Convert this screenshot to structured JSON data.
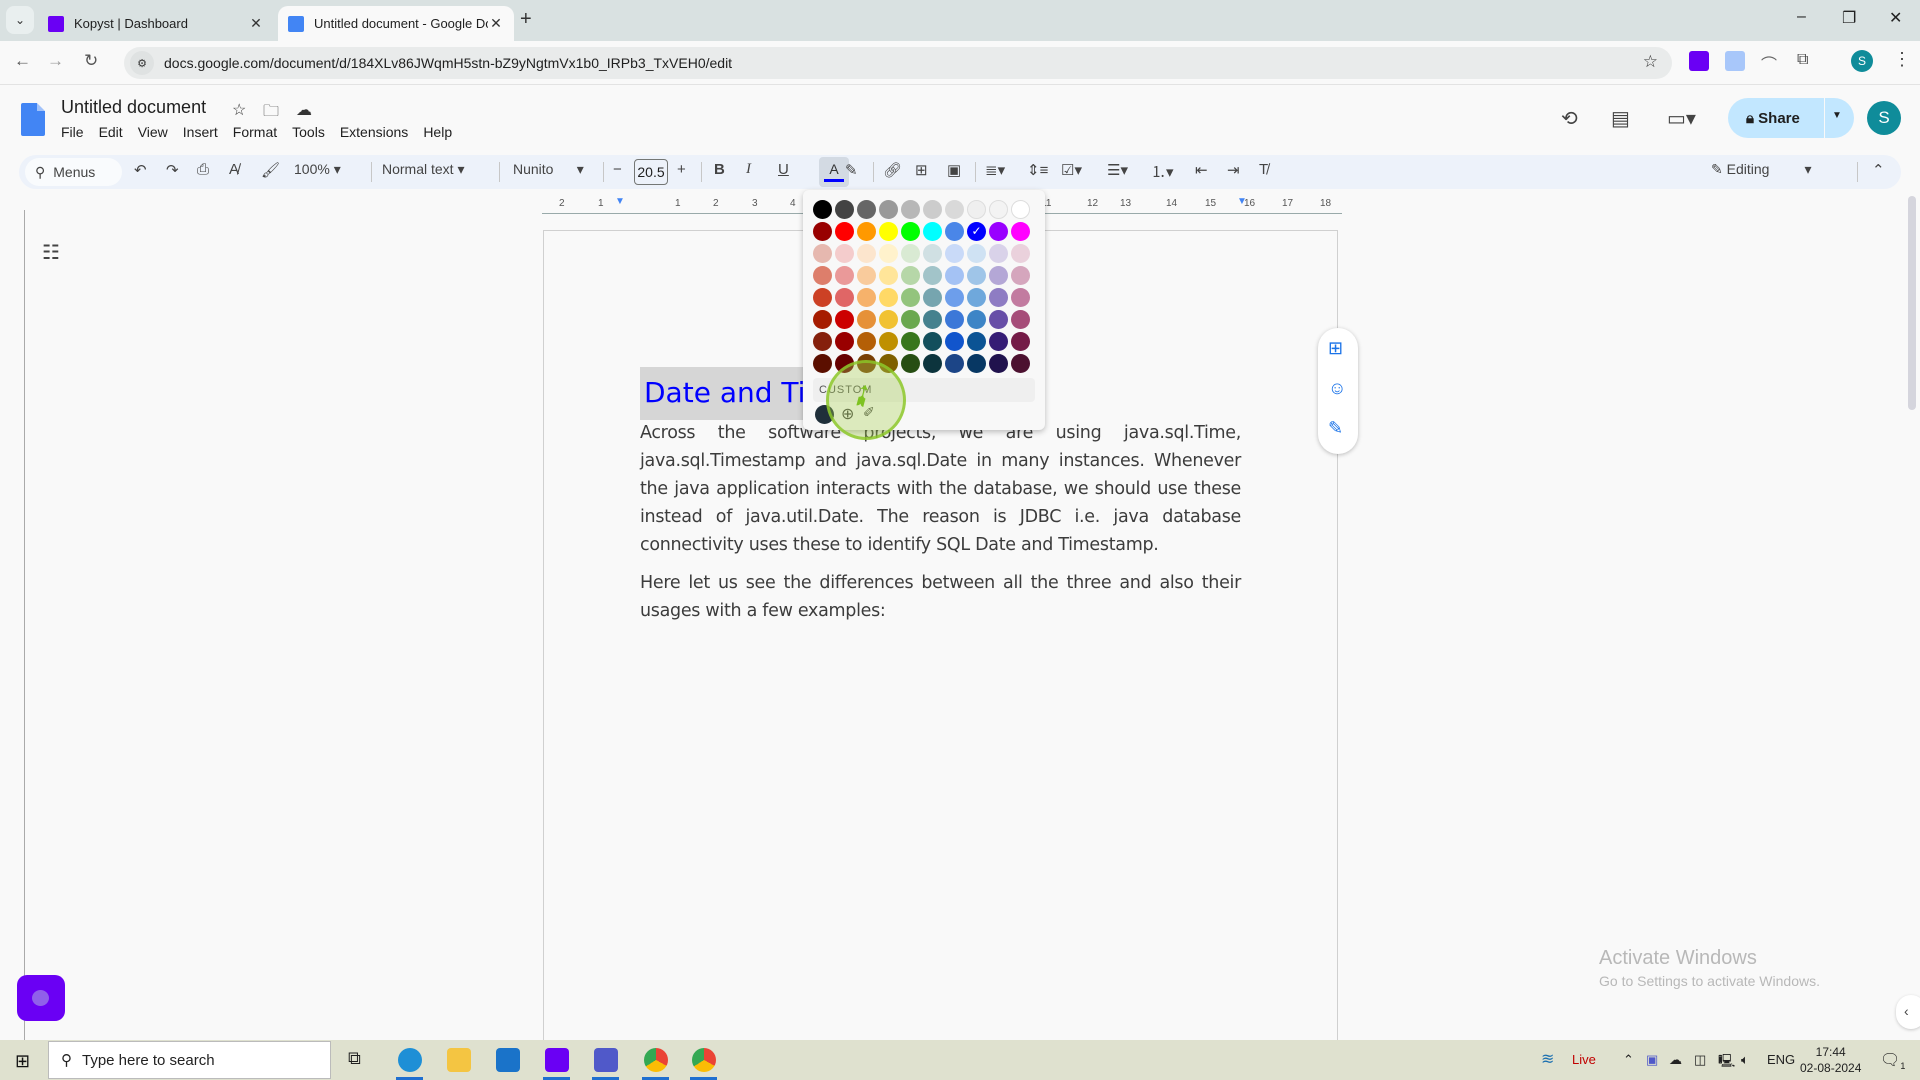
{
  "browser": {
    "tabs": [
      {
        "title": "Kopyst | Dashboard",
        "active": false
      },
      {
        "title": "Untitled document - Google Do",
        "active": true
      }
    ],
    "url": "docs.google.com/document/d/184XLv86JWqmH5stn-bZ9yNgtmVx1b0_IRPb3_TxVEH0/edit",
    "profile_initial": "S",
    "window_controls": {
      "minimize": "–",
      "restore": "❐",
      "close": "✕"
    }
  },
  "docs": {
    "title": "Untitled document",
    "menu": [
      "File",
      "Edit",
      "View",
      "Insert",
      "Format",
      "Tools",
      "Extensions",
      "Help"
    ],
    "share_label": "Share",
    "avatar_initial": "S",
    "toolbar": {
      "menus_search": "Menus",
      "zoom": "100%",
      "style": "Normal text",
      "font": "Nunito",
      "font_size": "20.5",
      "mode": "Editing",
      "text_color": "#0000ff"
    },
    "ruler_labels": [
      "2",
      "1",
      "1",
      "2",
      "3",
      "4",
      "11",
      "12",
      "13",
      "14",
      "15",
      "16",
      "17",
      "18"
    ],
    "content": {
      "heading": "Date and Time",
      "paragraphs": [
        "Across the software projects, we are using java.sql.Time, java.sql.Timestamp and java.sql.Date in many instances. Whenever the java application interacts with the database, we should use these instead of java.util.Date. The reason is JDBC i.e. java database connectivity uses these to identify SQL Date and Timestamp.",
        "Here let us see the differences between all the three and also their usages with a few examples:"
      ]
    },
    "color_palette": {
      "rows": [
        [
          "#000000",
          "#434343",
          "#666666",
          "#999999",
          "#b7b7b7",
          "#cccccc",
          "#d9d9d9",
          "#efefef",
          "#f3f3f3",
          "#ffffff"
        ],
        [
          "#980000",
          "#ff0000",
          "#ff9900",
          "#ffff00",
          "#00ff00",
          "#00ffff",
          "#4a86e8",
          "#0000ff",
          "#9900ff",
          "#ff00ff"
        ],
        [
          "#e6b8af",
          "#f4cccc",
          "#fce5cd",
          "#fff2cc",
          "#d9ead3",
          "#d0e0e3",
          "#c9daf8",
          "#cfe2f3",
          "#d9d2e9",
          "#ead1dc"
        ],
        [
          "#dd7e6b",
          "#ea9999",
          "#f9cb9c",
          "#ffe599",
          "#b6d7a8",
          "#a2c4c9",
          "#a4c2f4",
          "#9fc5e8",
          "#b4a7d6",
          "#d5a6bd"
        ],
        [
          "#cc4125",
          "#e06666",
          "#f6b26b",
          "#ffd966",
          "#93c47d",
          "#76a5af",
          "#6d9eeb",
          "#6fa8dc",
          "#8e7cc3",
          "#c27ba0"
        ],
        [
          "#a61c00",
          "#cc0000",
          "#e69138",
          "#f1c232",
          "#6aa84f",
          "#45818e",
          "#3c78d8",
          "#3d85c6",
          "#674ea7",
          "#a64d79"
        ],
        [
          "#85200c",
          "#990000",
          "#b45f06",
          "#bf9000",
          "#38761d",
          "#134f5c",
          "#1155cc",
          "#0b5394",
          "#351c75",
          "#741b47"
        ],
        [
          "#5b0f00",
          "#660000",
          "#783f04",
          "#7f6000",
          "#274e13",
          "#0c343d",
          "#1c4587",
          "#073763",
          "#20124d",
          "#4c1130"
        ]
      ],
      "selected": "#0000ff",
      "custom_label": "CUSTOM",
      "custom_colors": [
        "#1f2f3a"
      ]
    },
    "watermark": {
      "line1": "Activate Windows",
      "line2": "Go to Settings to activate Windows."
    }
  },
  "taskbar": {
    "search_placeholder": "Type here to search",
    "weather_label": "Live",
    "language": "ENG",
    "time": "17:44",
    "date": "02-08-2024",
    "notification_count": "1"
  }
}
